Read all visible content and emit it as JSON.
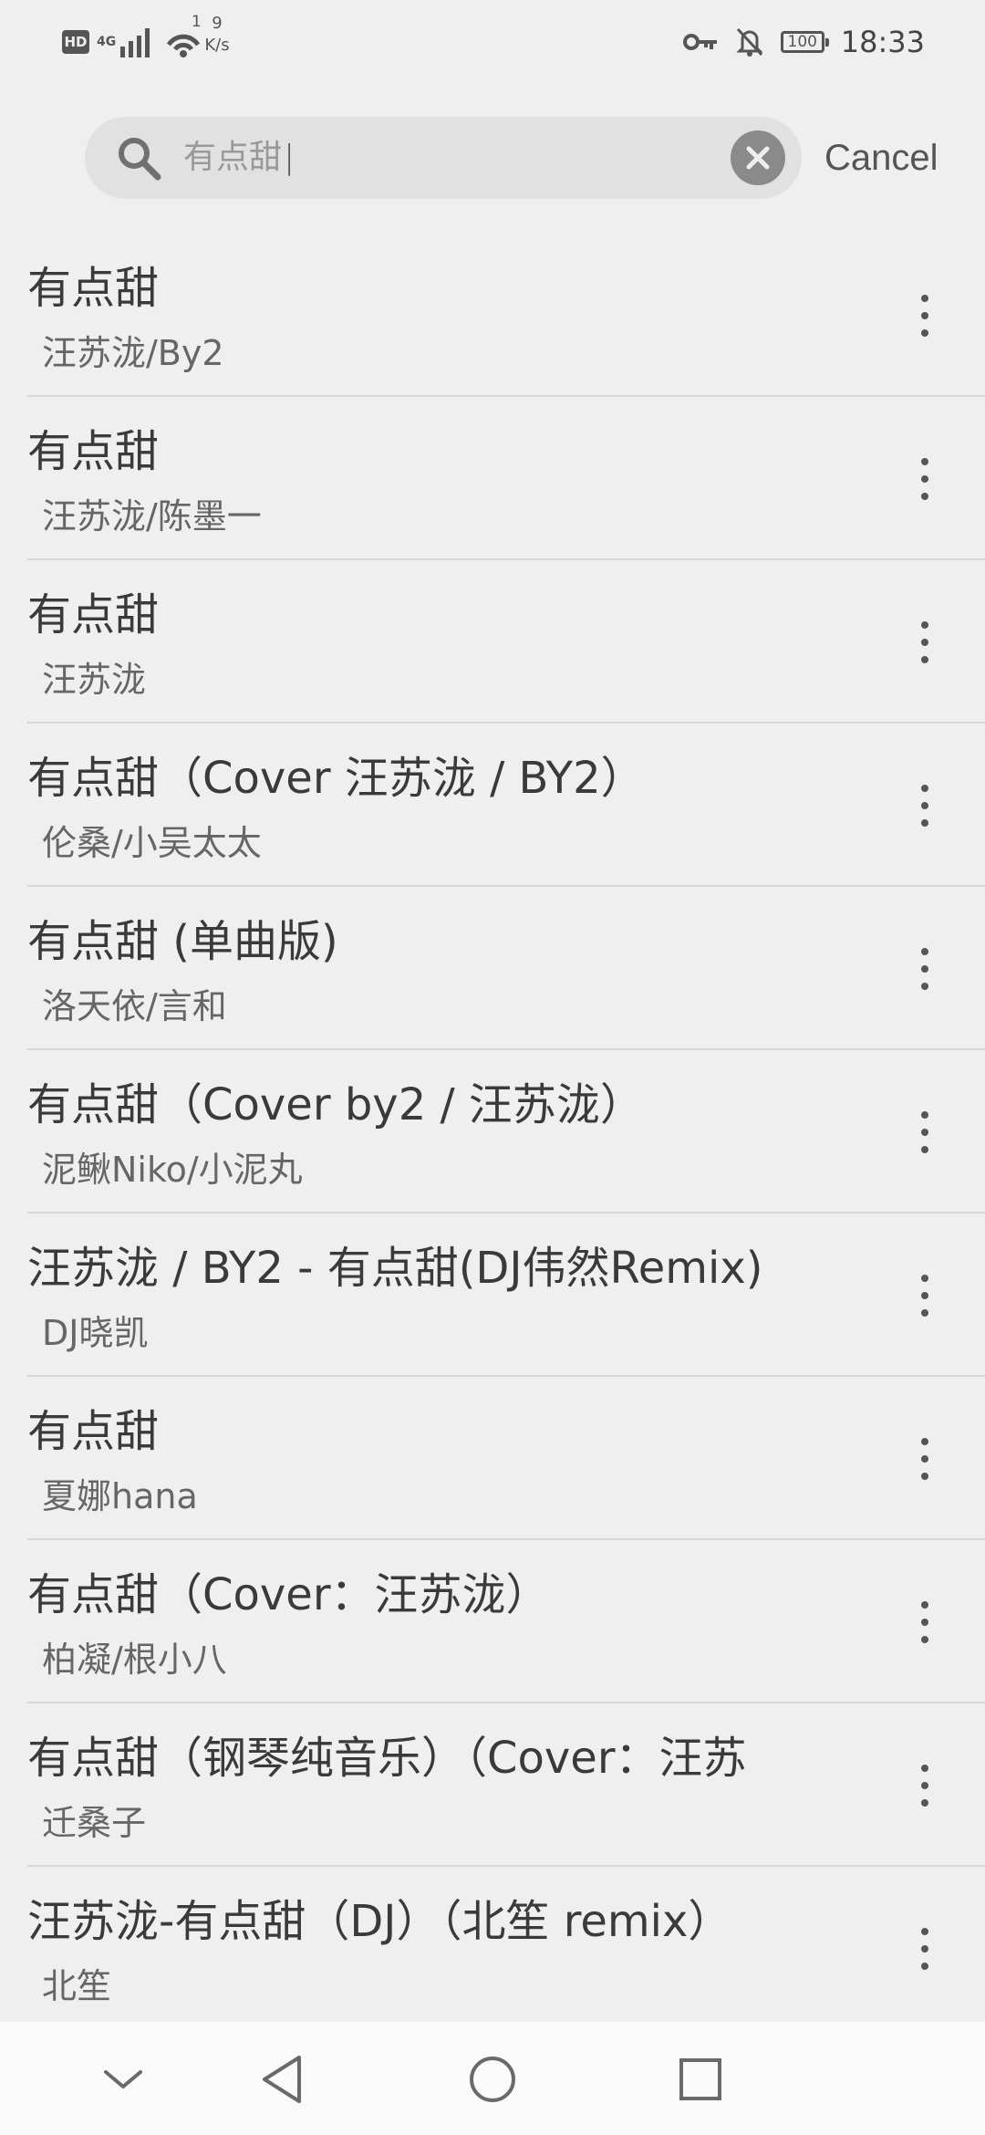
{
  "status_bar": {
    "hd_badge": "HD",
    "network_type": "4G",
    "wifi_superscript": "1",
    "net_speed_value": "9",
    "net_speed_unit": "K/s",
    "battery_level": "100",
    "time": "18:33",
    "icons": [
      "key-icon",
      "bell-off-icon"
    ]
  },
  "search": {
    "query": "有点甜",
    "cancel_label": "Cancel"
  },
  "results": [
    {
      "title": "有点甜",
      "artist": "汪苏泷/By2"
    },
    {
      "title": "有点甜",
      "artist": "汪苏泷/陈墨一"
    },
    {
      "title": "有点甜",
      "artist": "汪苏泷"
    },
    {
      "title": "有点甜（Cover 汪苏泷 / BY2）",
      "artist": "伦桑/小吴太太"
    },
    {
      "title": "有点甜 (单曲版)",
      "artist": "洛天依/言和"
    },
    {
      "title": "有点甜（Cover by2 / 汪苏泷）",
      "artist": "泥鳅Niko/小泥丸"
    },
    {
      "title": "汪苏泷 / BY2 - 有点甜(DJ伟然Remix)",
      "artist": "DJ晓凯"
    },
    {
      "title": "有点甜",
      "artist": "夏娜hana"
    },
    {
      "title": "有点甜（Cover：汪苏泷）",
      "artist": "柏凝/根小八"
    },
    {
      "title": "有点甜（钢琴纯音乐）（Cover：汪苏",
      "artist": "迁桑子"
    },
    {
      "title": "汪苏泷-有点甜（DJ）（北笙 remix）",
      "artist": "北笙"
    }
  ],
  "nav_bar": {
    "icons": [
      "chevron-down-icon",
      "back-icon",
      "home-icon",
      "recents-icon"
    ]
  }
}
